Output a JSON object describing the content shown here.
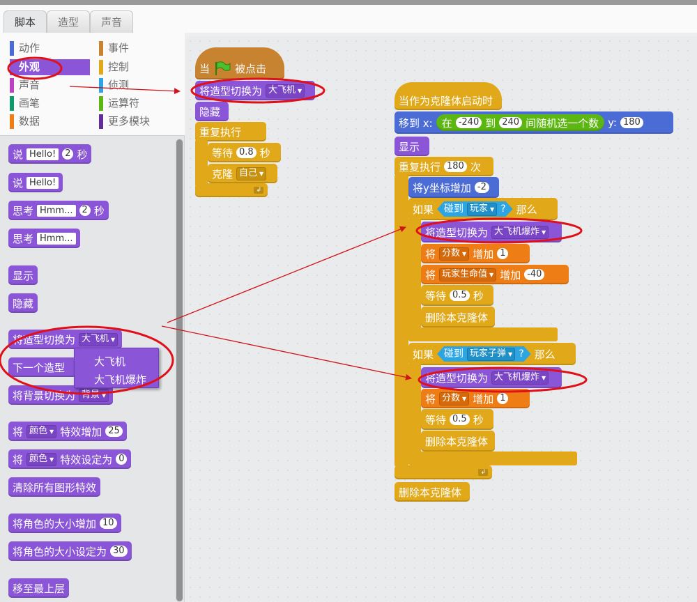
{
  "tabs": [
    "脚本",
    "造型",
    "声音"
  ],
  "categories": {
    "left": [
      {
        "label": "动作",
        "color": "#4a6cd4"
      },
      {
        "label": "外观",
        "color": "#8a55d7"
      },
      {
        "label": "声音",
        "color": "#bb42c3"
      },
      {
        "label": "画笔",
        "color": "#0e9a6c"
      },
      {
        "label": "数据",
        "color": "#ee7d16"
      }
    ],
    "right": [
      {
        "label": "事件",
        "color": "#c88330"
      },
      {
        "label": "控制",
        "color": "#e1a91a"
      },
      {
        "label": "侦测",
        "color": "#2ca5e2"
      },
      {
        "label": "运算符",
        "color": "#5cb712"
      },
      {
        "label": "更多模块",
        "color": "#632d99"
      }
    ],
    "selected": "外观"
  },
  "palette": {
    "say_secs": {
      "label": "说",
      "text": "Hello!",
      "secs": "2",
      "unit": "秒"
    },
    "say": {
      "label": "说",
      "text": "Hello!"
    },
    "think_secs": {
      "label": "思考",
      "text": "Hmm...",
      "secs": "2",
      "unit": "秒"
    },
    "think": {
      "label": "思考",
      "text": "Hmm..."
    },
    "show": "显示",
    "hide": "隐藏",
    "switch_costume": {
      "label": "将造型切换为",
      "value": "大飞机"
    },
    "next_costume": "下一个造型",
    "switch_backdrop": {
      "label": "将背景切换为",
      "value": "背景"
    },
    "change_effect": {
      "label": "将",
      "effect": "颜色",
      "mid": "特效增加",
      "value": "25"
    },
    "set_effect": {
      "label": "将",
      "effect": "颜色",
      "mid": "特效设定为",
      "value": "0"
    },
    "clear_effects": "清除所有图形特效",
    "change_size": {
      "label": "将角色的大小增加",
      "value": "10"
    },
    "set_size": {
      "label": "将角色的大小设定为",
      "value": "30"
    },
    "front": "移至最上层"
  },
  "costume_menu": [
    "大飞机",
    "大飞机爆炸"
  ],
  "script1": {
    "hat_when": "当",
    "hat_clicked": "被点击",
    "switch_label": "将造型切换为",
    "switch_value": "大飞机",
    "hide": "隐藏",
    "forever": "重复执行",
    "wait_label": "等待",
    "wait_value": "0.8",
    "wait_unit": "秒",
    "clone_label": "克隆",
    "clone_value": "自己"
  },
  "script2": {
    "hat": "当作为克隆体启动时",
    "goto_label": "移到 x:",
    "random_in": "在",
    "random_from": "-240",
    "random_to_word": "到",
    "random_to": "240",
    "random_rest": "间随机选一个数",
    "goto_y": "y:",
    "goto_y_value": "180",
    "show": "显示",
    "repeat_label": "重复执行",
    "repeat_value": "180",
    "repeat_unit": "次",
    "change_y_label": "将y坐标增加",
    "change_y_value": "-2",
    "if1_label": "如果",
    "touch_label": "碰到",
    "touch1_value": "玩家",
    "touch_q": "?",
    "then_label": "那么",
    "switch_label": "将造型切换为",
    "switch1_value": "大飞机爆炸",
    "set_label": "将",
    "var_score": "分数",
    "var_life": "玩家生命值",
    "add_label": "增加",
    "score_add": "1",
    "life_add": "-40",
    "wait_label": "等待",
    "wait_value": "0.5",
    "wait_unit": "秒",
    "delete_clone": "删除本克隆体",
    "touch2_value": "玩家子弹",
    "switch2_value": "大飞机爆炸"
  }
}
